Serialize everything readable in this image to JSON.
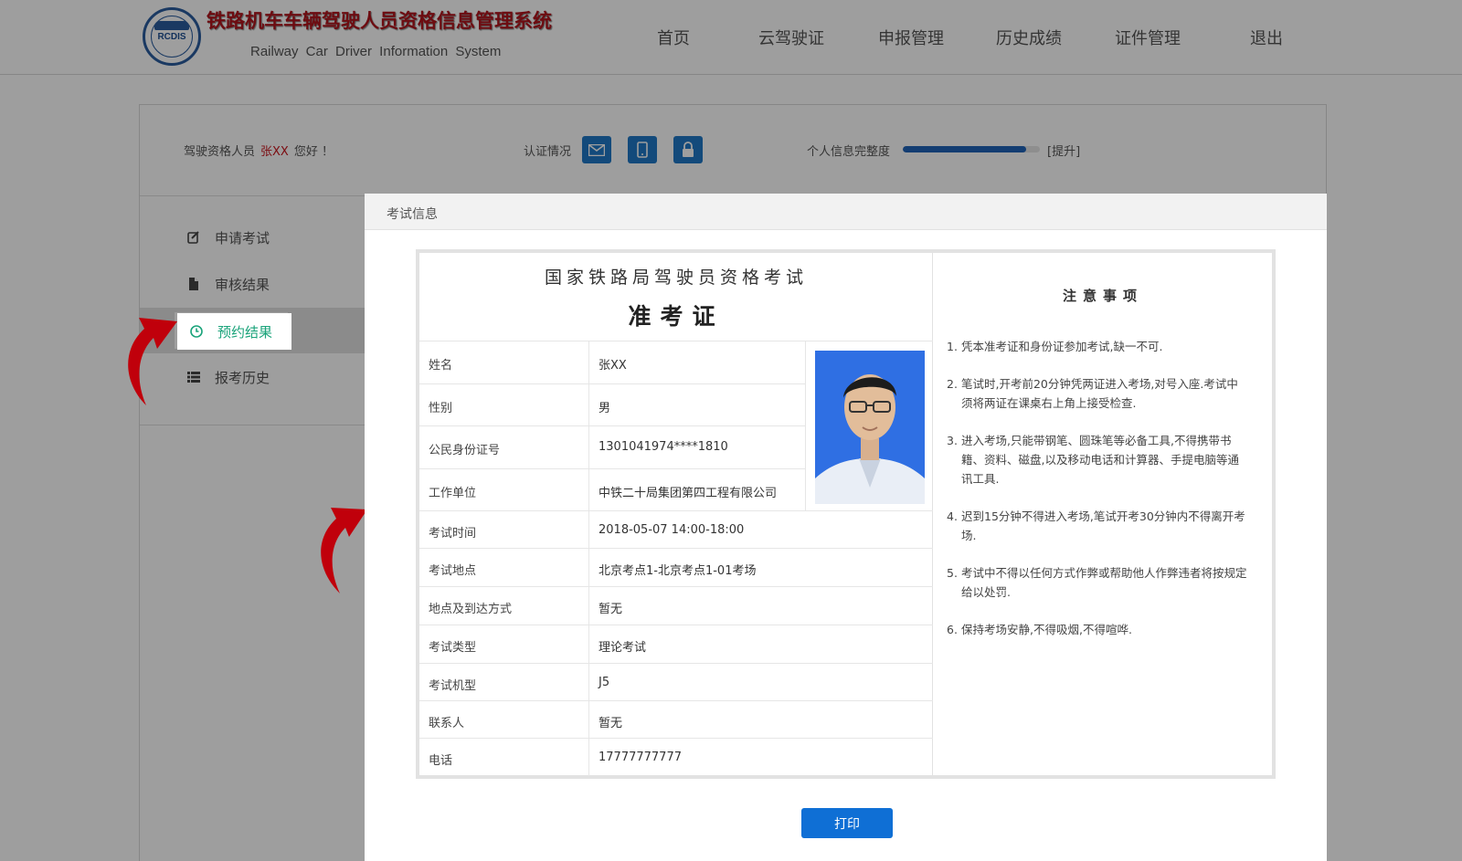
{
  "header": {
    "logo_text": "RCDIS",
    "title": "铁路机车车辆驾驶人员资格信息管理系统",
    "subtitle": "Railway Car Driver Information System",
    "nav": [
      "首页",
      "云驾驶证",
      "申报管理",
      "历史成绩",
      "证件管理",
      "退出"
    ]
  },
  "userbar": {
    "greeting_prefix": "驾驶资格人员",
    "user_name": "张XX",
    "greeting_suffix": "您好 ！",
    "auth_label": "认证情况",
    "auth_icons": [
      "mail-icon",
      "mobile-icon",
      "lock-icon"
    ],
    "completion_label": "个人信息完整度",
    "completion_percent": 90,
    "improve_label": "[提升]"
  },
  "sidebar": {
    "items": [
      {
        "label": "申请考试",
        "icon": "edit-icon"
      },
      {
        "label": "审核结果",
        "icon": "file-icon"
      },
      {
        "label": "预约结果",
        "icon": "clock-icon",
        "active": true
      },
      {
        "label": "报考历史",
        "icon": "list-icon"
      }
    ]
  },
  "modal": {
    "title": "考试信息",
    "exam_name": "国家铁路局驾驶员资格考试",
    "ticket_title": "准考证",
    "fields": [
      {
        "label": "姓名",
        "value": "张XX"
      },
      {
        "label": "性别",
        "value": "男"
      },
      {
        "label": "公民身份证号",
        "value": "1301041974****1810"
      },
      {
        "label": "工作单位",
        "value": "中铁二十局集团第四工程有限公司"
      },
      {
        "label": "考试时间",
        "value": "2018-05-07  14:00-18:00"
      },
      {
        "label": "考试地点",
        "value": "北京考点1-北京考点1-01考场"
      },
      {
        "label": "地点及到达方式",
        "value": "暂无"
      },
      {
        "label": "考试类型",
        "value": "理论考试"
      },
      {
        "label": "考试机型",
        "value": "J5"
      },
      {
        "label": "联系人",
        "value": "暂无"
      },
      {
        "label": "电话",
        "value": "17777777777"
      }
    ],
    "notes_title": "注意事项",
    "notes": [
      {
        "num": "1.",
        "text": "凭本准考证和身份证参加考试,缺一不可."
      },
      {
        "num": "2.",
        "text": "笔试时,开考前20分钟凭两证进入考场,对号入座.考试中须将两证在课桌右上角上接受检查."
      },
      {
        "num": "3.",
        "text": "进入考场,只能带钢笔、圆珠笔等必备工具,不得携带书籍、资料、磁盘,以及移动电话和计算器、手提电脑等通讯工具."
      },
      {
        "num": "4.",
        "text": "迟到15分钟不得进入考场,笔试开考30分钟内不得离开考场."
      },
      {
        "num": "5.",
        "text": "考试中不得以任何方式作弊或帮助他人作弊违者将按规定给以处罚."
      },
      {
        "num": "6.",
        "text": "保持考场安静,不得吸烟,不得喧哗."
      }
    ],
    "print_label": "打印"
  },
  "colors": {
    "brand_red": "#b0141c",
    "primary_blue": "#0f6fd5",
    "active_green": "#1aa37a",
    "annotation_arrow": "#c0000b"
  }
}
